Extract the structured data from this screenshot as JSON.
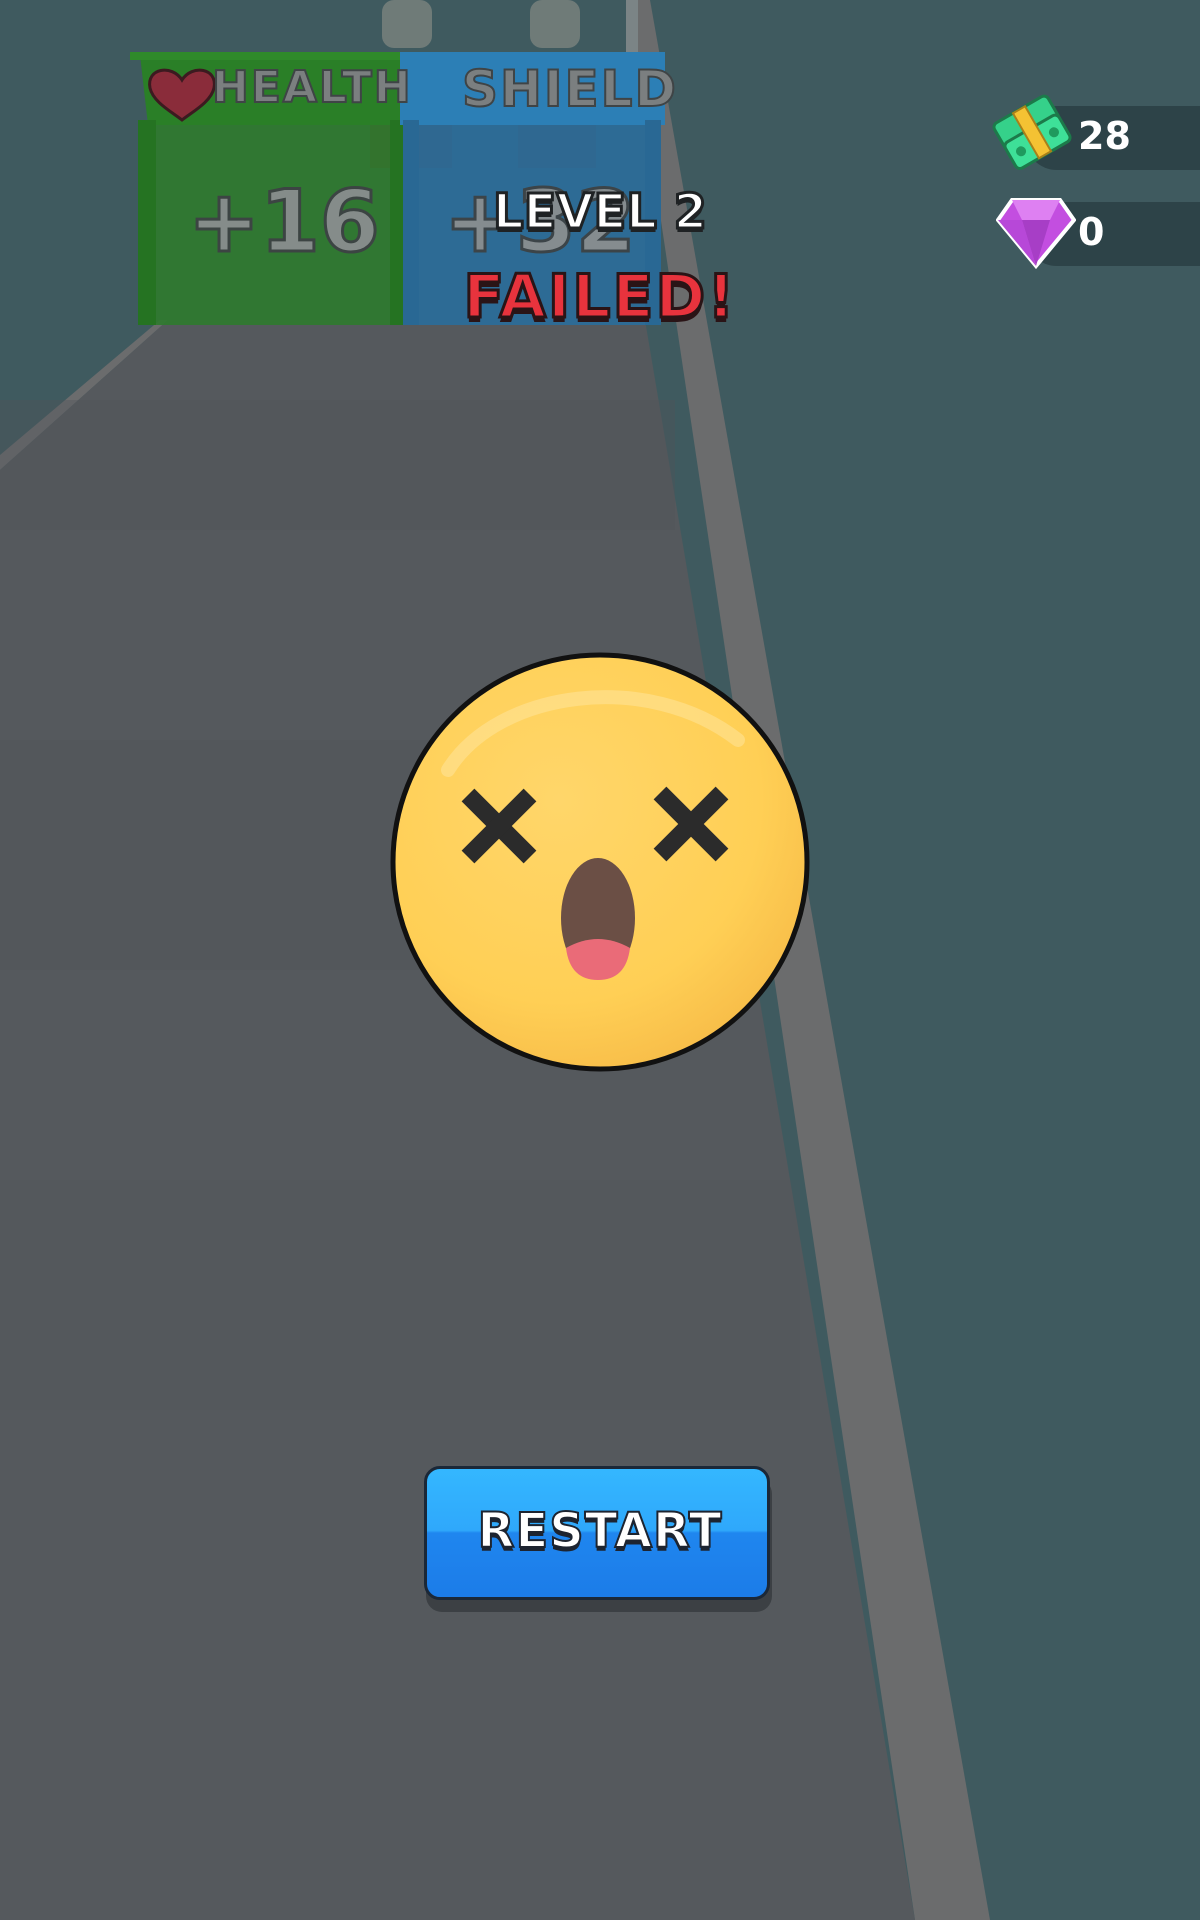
{
  "hud": {
    "cash_icon": "cash-stack-icon",
    "cash_value": "28",
    "gem_icon": "purple-gem-icon",
    "gem_value": "0"
  },
  "gates": [
    {
      "title": "HEALTH",
      "icon": "heart-icon",
      "value": "+16",
      "color": "#2f8a2a"
    },
    {
      "title": "SHIELD",
      "value": "+32",
      "color": "#2c7fb6"
    }
  ],
  "result": {
    "level_label": "LEVEL 2",
    "status_label": "FAILED!",
    "face_icon": "dizzy-face-icon"
  },
  "actions": {
    "restart_label": "RESTART",
    "restart_color": "#2196f3"
  }
}
